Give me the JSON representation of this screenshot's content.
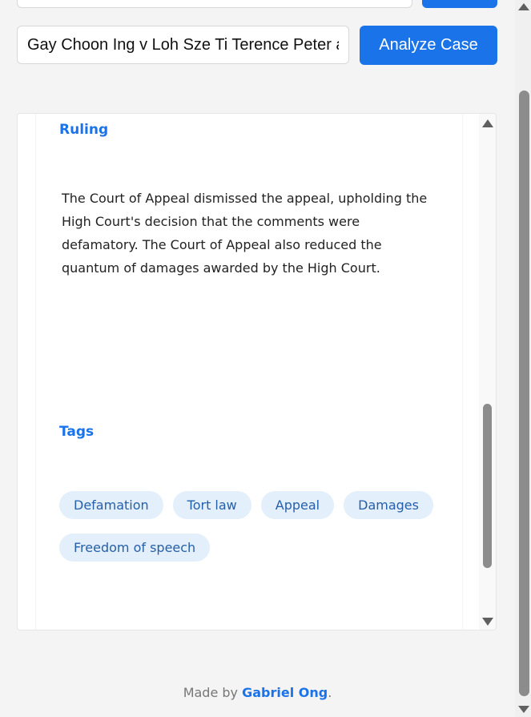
{
  "search": {
    "case_value": "Gay Choon Ing v Loh Sze Ti Terence Peter and another appeal",
    "analyze_label": "Analyze Case"
  },
  "result": {
    "ruling_heading": "Ruling",
    "ruling_text": "The Court of Appeal dismissed the appeal, upholding the High Court's decision that the comments were defamatory. The Court of Appeal also reduced the quantum of damages awarded by the High Court.",
    "tags_heading": "Tags",
    "tags": [
      "Defamation",
      "Tort law",
      "Appeal",
      "Damages",
      "Freedom of speech"
    ]
  },
  "footer": {
    "prefix": "Made by ",
    "author": "Gabriel Ong",
    "suffix": "."
  },
  "colors": {
    "accent": "#1a73e8",
    "tag_background": "#e3effb",
    "tag_text": "#2560a8",
    "page_background": "#f4f4f4"
  }
}
